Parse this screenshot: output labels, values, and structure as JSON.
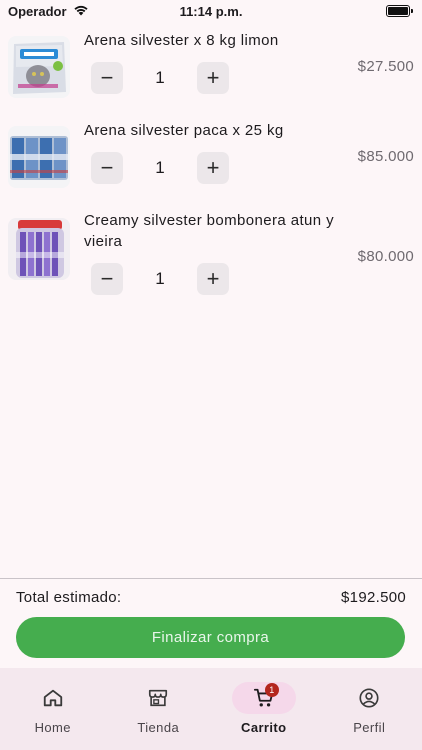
{
  "status_bar": {
    "carrier": "Operador",
    "time": "11:14 p.m."
  },
  "cart": {
    "items": [
      {
        "name": "Arena silvester x 8 kg limon",
        "quantity": "1",
        "price": "$27.500",
        "image": "cat-litter-bag-image"
      },
      {
        "name": "Arena silvester paca x 25 kg",
        "quantity": "1",
        "price": "$85.000",
        "image": "cat-litter-pack-image"
      },
      {
        "name": "Creamy silvester bombonera atun y vieira",
        "quantity": "1",
        "price": "$80.000",
        "image": "cat-treats-jar-image"
      }
    ],
    "decrement_symbol": "−",
    "increment_symbol": "+"
  },
  "summary": {
    "label": "Total estimado:",
    "total": "$192.500"
  },
  "checkout": {
    "label": "Finalizar compra"
  },
  "nav": {
    "items": [
      {
        "label": "Home",
        "icon": "home-icon"
      },
      {
        "label": "Tienda",
        "icon": "store-icon"
      },
      {
        "label": "Carrito",
        "icon": "cart-icon",
        "badge": "1",
        "active": true
      },
      {
        "label": "Perfil",
        "icon": "profile-icon"
      }
    ]
  },
  "colors": {
    "accent": "#45ad4e",
    "badge": "#b3261e",
    "nav_background": "#f4e8ee",
    "active_indicator": "#f5d8ea"
  }
}
